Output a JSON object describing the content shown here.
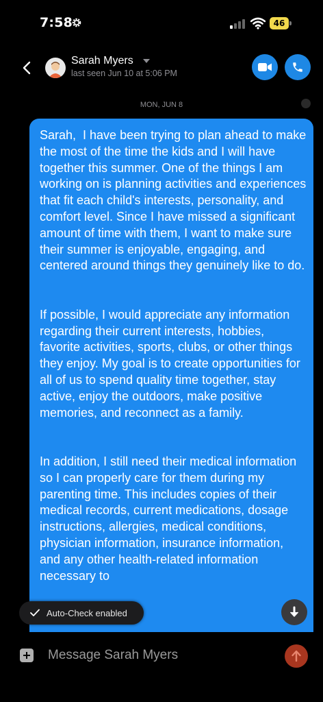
{
  "status_bar": {
    "time": "7:58",
    "battery": "46"
  },
  "header": {
    "contact_name": "Sarah Myers",
    "last_seen": "last seen Jun 10 at 5:06 PM"
  },
  "conversation": {
    "date_divider": "MON, JUN 8",
    "message_text": "Sarah,  I have been trying to plan ahead to make the most of the time the kids and I will have together this summer. One of the things I am working on is planning activities and experiences that fit each child's interests, personality, and comfort level. Since I have missed a significant amount of time with them, I want to make sure their summer is enjoyable, engaging, and centered around things they genuinely like to do.\n\n\nIf possible, I would appreciate any information regarding their current interests, hobbies, favorite activities, sports, clubs, or other things they enjoy. My goal is to create opportunities for all of us to spend quality time together, stay active, enjoy the outdoors, make positive memories, and reconnect as a family.\n\n\nIn addition, I still need their medical information so I can properly care for them during my parenting time. This includes copies of their medical records, current medications, dosage instructions, allergies, medical conditions, physician information, insurance information, and any other health-related information necessary to"
  },
  "auto_check": {
    "label": "Auto-Check enabled"
  },
  "composer": {
    "placeholder": "Message Sarah Myers"
  },
  "colors": {
    "accent": "#1e88e5",
    "bubble": "#1e8af0",
    "send": "#a8361f",
    "battery": "#f2d94c"
  },
  "icons": [
    "gear-icon",
    "signal-icon",
    "wifi-icon",
    "battery-icon",
    "back-chevron-icon",
    "avatar",
    "chevron-down-icon",
    "video-icon",
    "phone-icon",
    "check-icon",
    "arrow-down-icon",
    "plus-icon",
    "arrow-up-icon"
  ]
}
